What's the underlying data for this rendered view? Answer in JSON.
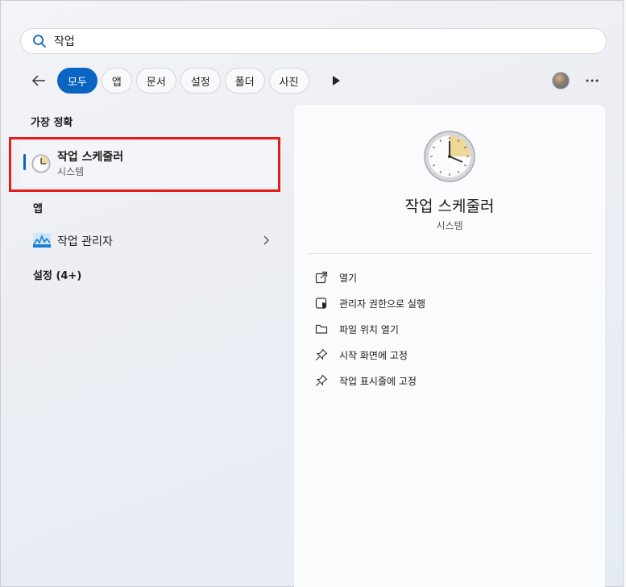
{
  "search": {
    "value": "작업",
    "icon": "search-icon"
  },
  "filters": {
    "back_icon": "back-arrow-icon",
    "items": [
      {
        "label": "모두",
        "active": true
      },
      {
        "label": "앱",
        "active": false
      },
      {
        "label": "문서",
        "active": false
      },
      {
        "label": "설정",
        "active": false
      },
      {
        "label": "폴더",
        "active": false
      },
      {
        "label": "사진",
        "active": false
      }
    ],
    "more_icon": "play-arrow-icon",
    "menu_icon": "ellipsis-icon"
  },
  "best_match": {
    "section": "가장 정확",
    "name": "작업 스케줄러",
    "type": "시스템",
    "icon": "clock-icon"
  },
  "apps": {
    "section": "앱",
    "items": [
      {
        "name": "작업 관리자",
        "icon": "task-manager-icon"
      }
    ]
  },
  "settings": {
    "section": "설정 (4+)"
  },
  "detail": {
    "title": "작업 스케줄러",
    "subtitle": "시스템",
    "actions": [
      {
        "label": "열기",
        "icon": "open-external-icon"
      },
      {
        "label": "관리자 권한으로 실행",
        "icon": "shield-icon"
      },
      {
        "label": "파일 위치 열기",
        "icon": "folder-icon"
      },
      {
        "label": "시작 화면에 고정",
        "icon": "pin-icon"
      },
      {
        "label": "작업 표시줄에 고정",
        "icon": "pin-icon"
      }
    ]
  },
  "colors": {
    "accent": "#0a64c2",
    "highlight": "#e0201b"
  }
}
